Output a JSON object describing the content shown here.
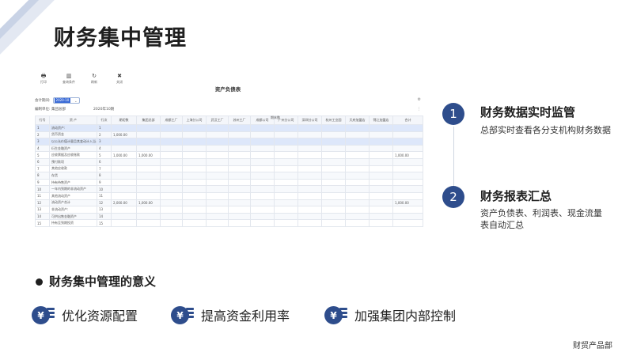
{
  "title": "财务集中管理",
  "toolbar": [
    {
      "icon": "print-icon",
      "glyph": "🖶",
      "label": "打印"
    },
    {
      "icon": "view-icon",
      "glyph": "▥",
      "label": "查询条件"
    },
    {
      "icon": "refresh-icon",
      "glyph": "↻",
      "label": "刷新"
    },
    {
      "icon": "close-icon",
      "glyph": "✖",
      "label": "关闭"
    }
  ],
  "report": {
    "title": "资产负债表",
    "period_label": "会计期间:",
    "period_value": "2020-10",
    "unit_label": "编制单位:",
    "unit_value": "集团总部",
    "date": "2020年10期"
  },
  "table": {
    "headers": [
      "行号",
      "资 产",
      "行次",
      "期初数",
      "集团总部",
      "成都工厂",
      "上海分公司",
      "武汉工厂",
      "苏州工厂",
      "成都公司",
      "广州分公司",
      "深圳分公司",
      "杭州工业园",
      "天府加盟店",
      "锦江加盟店",
      "合计"
    ],
    "group_header": "期末数",
    "rows": [
      [
        "1",
        "流动资产:",
        "1",
        "",
        "",
        "",
        "",
        "",
        "",
        "",
        "",
        "",
        "",
        "",
        "",
        ""
      ],
      [
        "2",
        "货币资金",
        "2",
        "1,000.00",
        "",
        "",
        "",
        "",
        "",
        "",
        "",
        "",
        "",
        "",
        "",
        ""
      ],
      [
        "3",
        "以公允价值计量且其变动计入当...",
        "3",
        "",
        "",
        "",
        "",
        "",
        "",
        "",
        "",
        "",
        "",
        "",
        "",
        ""
      ],
      [
        "4",
        "衍生金融资产",
        "4",
        "",
        "",
        "",
        "",
        "",
        "",
        "",
        "",
        "",
        "",
        "",
        "",
        ""
      ],
      [
        "5",
        "应收票据及应收账款",
        "5",
        "1,000.00",
        "1,000.00",
        "",
        "",
        "",
        "",
        "",
        "",
        "",
        "",
        "",
        "",
        "1,000.00"
      ],
      [
        "6",
        "预付款项",
        "6",
        "",
        "",
        "",
        "",
        "",
        "",
        "",
        "",
        "",
        "",
        "",
        "",
        ""
      ],
      [
        "7",
        "其他应收款",
        "7",
        "",
        "",
        "",
        "",
        "",
        "",
        "",
        "",
        "",
        "",
        "",
        "",
        ""
      ],
      [
        "8",
        "存货",
        "8",
        "",
        "",
        "",
        "",
        "",
        "",
        "",
        "",
        "",
        "",
        "",
        "",
        ""
      ],
      [
        "9",
        "持有待售资产",
        "9",
        "",
        "",
        "",
        "",
        "",
        "",
        "",
        "",
        "",
        "",
        "",
        "",
        ""
      ],
      [
        "10",
        "一年内到期的非流动资产",
        "10",
        "",
        "",
        "",
        "",
        "",
        "",
        "",
        "",
        "",
        "",
        "",
        "",
        ""
      ],
      [
        "11",
        "其他流动资产",
        "11",
        "",
        "",
        "",
        "",
        "",
        "",
        "",
        "",
        "",
        "",
        "",
        "",
        ""
      ],
      [
        "12",
        "流动资产合计",
        "12",
        "2,000.00",
        "1,000.00",
        "",
        "",
        "",
        "",
        "",
        "",
        "",
        "",
        "",
        "",
        "1,000.00"
      ],
      [
        "13",
        "非流动资产:",
        "13",
        "",
        "",
        "",
        "",
        "",
        "",
        "",
        "",
        "",
        "",
        "",
        "",
        ""
      ],
      [
        "14",
        "可供出售金融资产",
        "14",
        "",
        "",
        "",
        "",
        "",
        "",
        "",
        "",
        "",
        "",
        "",
        "",
        ""
      ],
      [
        "15",
        "持有至到期投资",
        "15",
        "",
        "",
        "",
        "",
        "",
        "",
        "",
        "",
        "",
        "",
        "",
        "",
        ""
      ]
    ],
    "selected_rows": [
      0,
      2
    ]
  },
  "items": [
    {
      "number": "1",
      "title": "财务数据实时监管",
      "desc": "总部实时查看各分支机构财务数据"
    },
    {
      "number": "2",
      "title": "财务报表汇总",
      "desc": "资产负债表、利润表、现金流量表自动汇总"
    }
  ],
  "section": {
    "title": "财务集中管理的意义",
    "features": [
      "优化资源配置",
      "提高资金利用率",
      "加强集团内部控制"
    ],
    "coin_glyph": "¥"
  },
  "footer": "财贸产品部"
}
